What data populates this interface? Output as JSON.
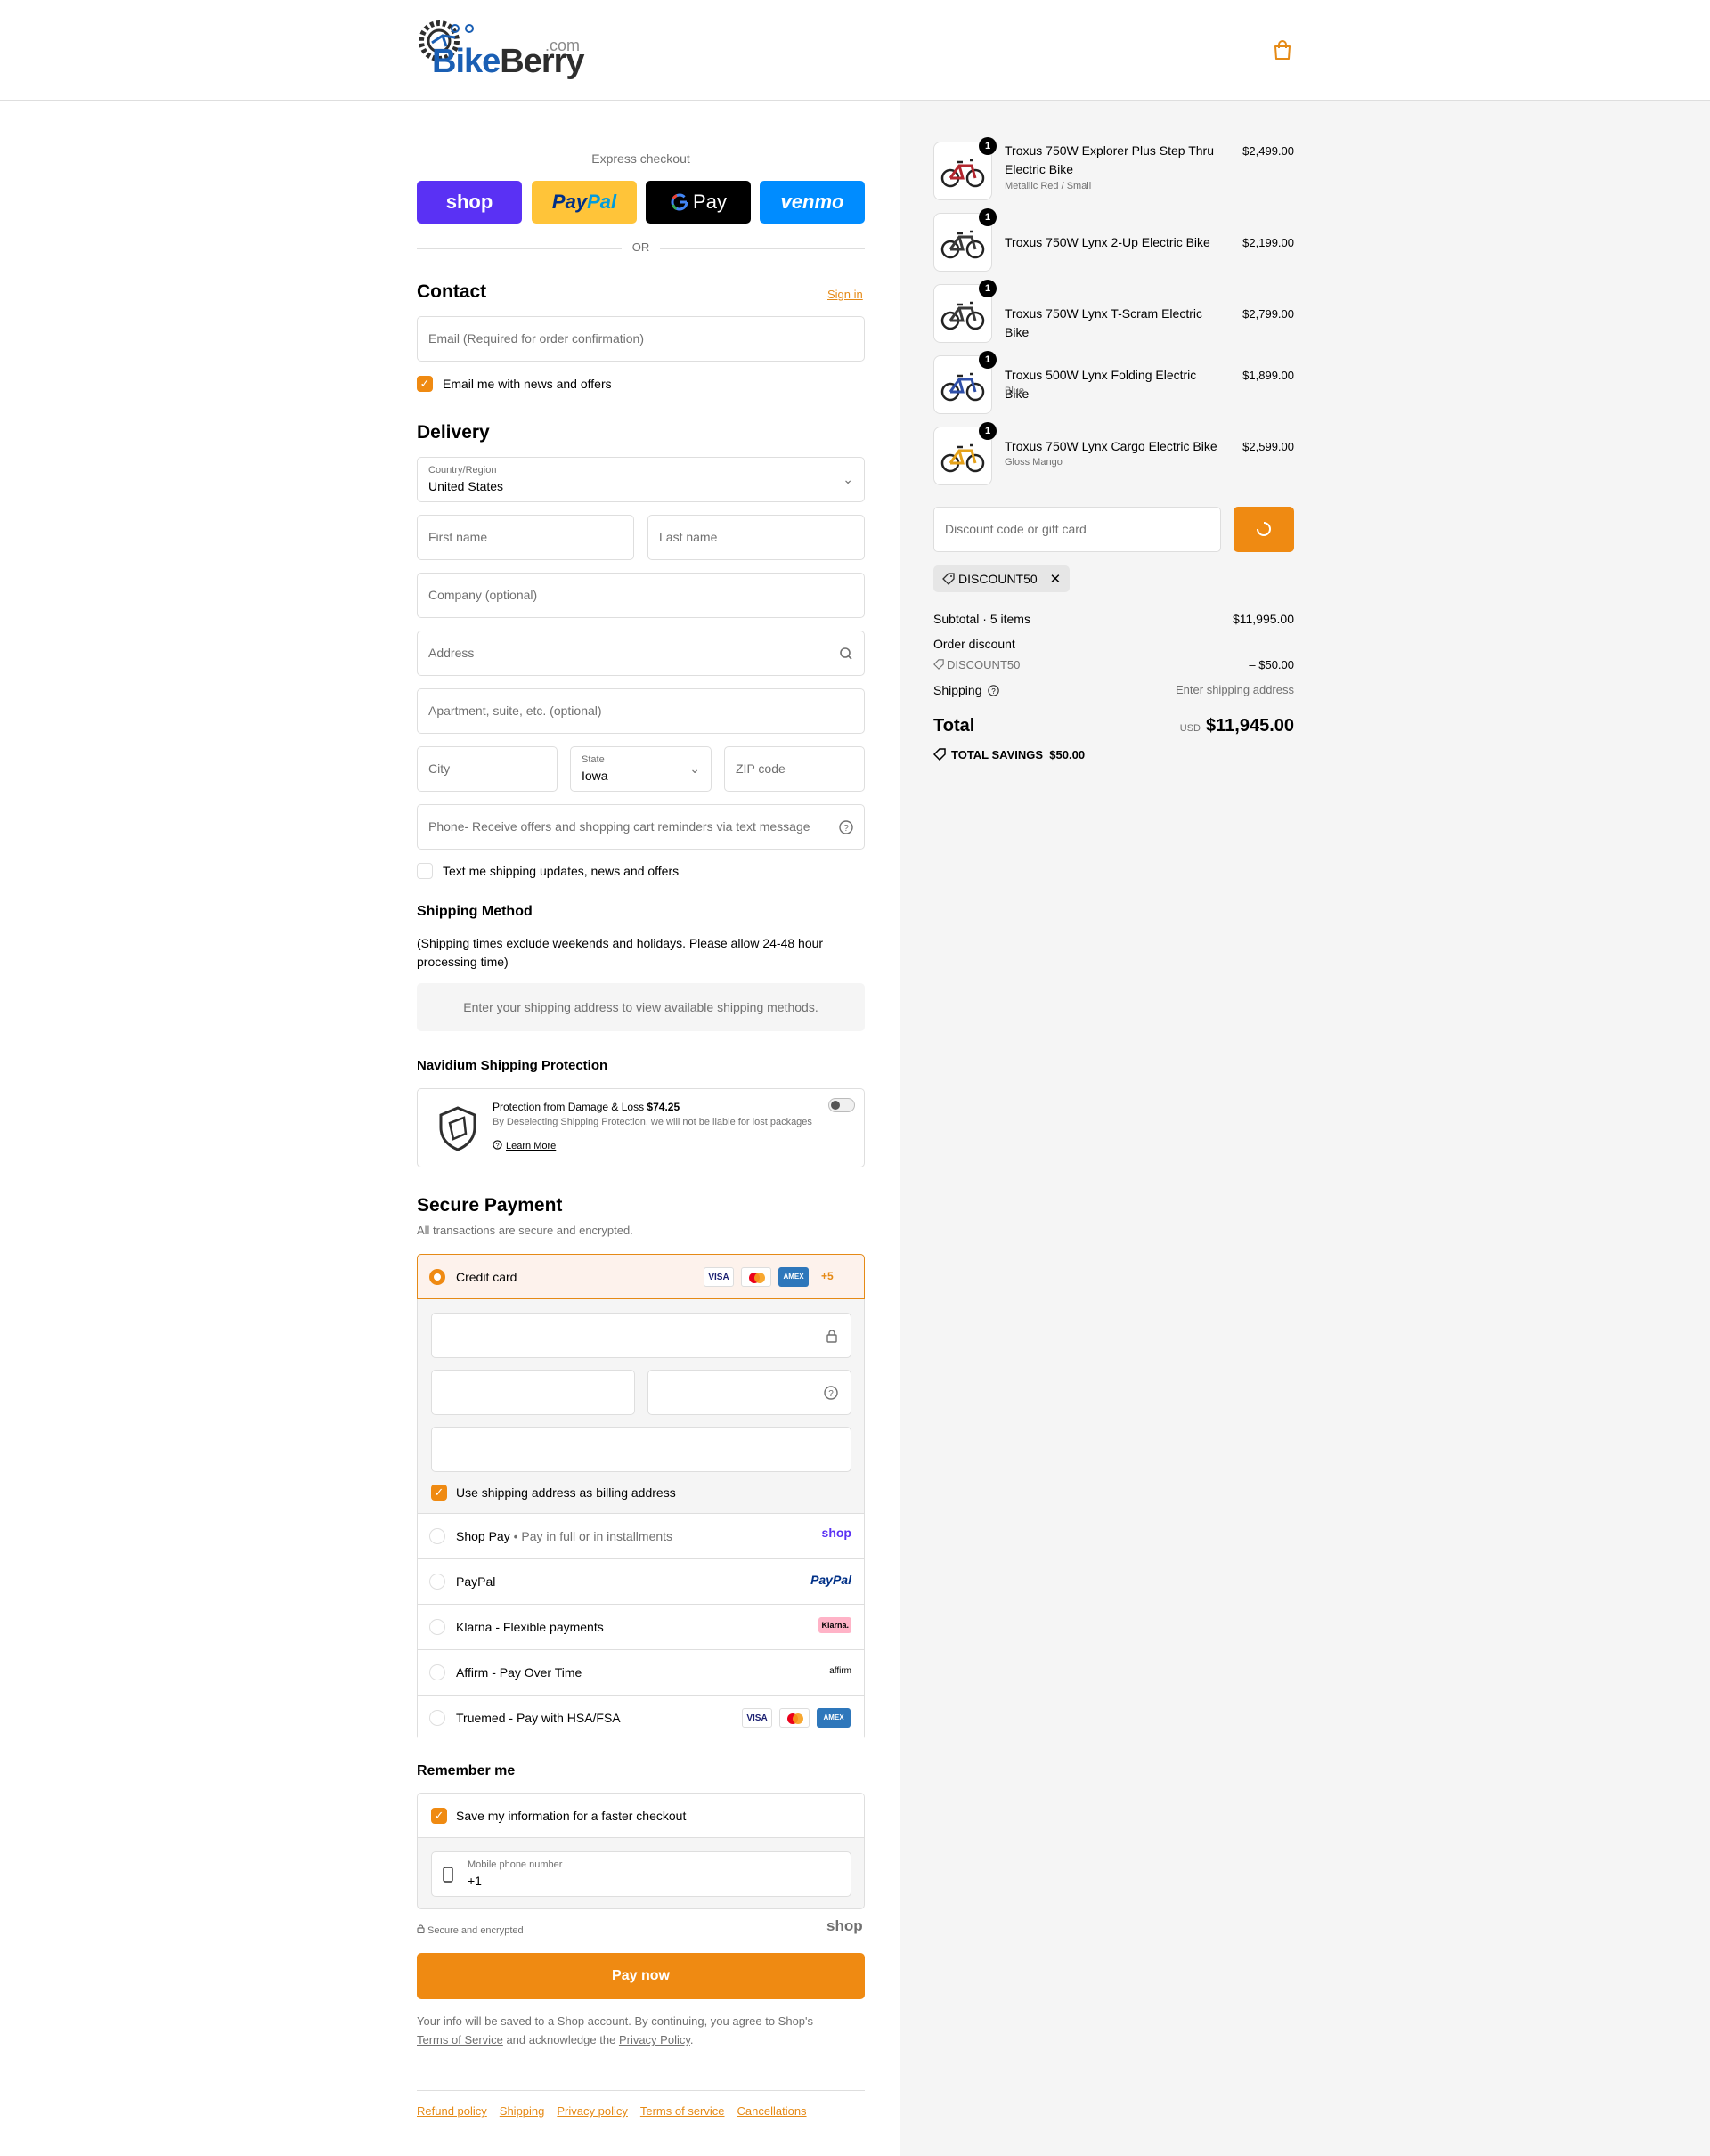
{
  "header": {
    "logo_text_1": "Bike",
    "logo_text_2": "Berry",
    "logo_com": ".com"
  },
  "express": {
    "label": "Express checkout",
    "shop": "shop",
    "paypal_1": "Pay",
    "paypal_2": "Pal",
    "gpay": "Pay",
    "venmo": "venmo",
    "or": "OR"
  },
  "contact": {
    "title": "Contact",
    "sign_in": "Sign in",
    "email_placeholder": "Email (Required for order confirmation)",
    "news_label": "Email me with news and offers"
  },
  "delivery": {
    "title": "Delivery",
    "country_label": "Country/Region",
    "country_value": "United States",
    "first_name": "First name",
    "last_name": "Last name",
    "company": "Company (optional)",
    "address": "Address",
    "apartment": "Apartment, suite, etc. (optional)",
    "city": "City",
    "state_label": "State",
    "state_value": "Iowa",
    "zip": "ZIP code",
    "phone": "Phone- Receive offers and shopping cart reminders via text message",
    "text_me": "Text me shipping updates, news and offers"
  },
  "shipping_method": {
    "title": "Shipping Method",
    "note": "(Shipping times exclude weekends and holidays. Please allow 24-48 hour processing time)",
    "info": "Enter your shipping address to view available shipping methods."
  },
  "protection": {
    "title": "Navidium Shipping Protection",
    "line1": "Protection from Damage & Loss",
    "amount": "$74.25",
    "line2": "By Deselecting Shipping Protection, we will not be liable for lost packages",
    "learn_more": "Learn More"
  },
  "payment": {
    "title": "Secure Payment",
    "subtitle": "All transactions are secure and encrypted.",
    "credit_card": "Credit card",
    "more_cards": "+5",
    "billing_label": "Use shipping address as billing address",
    "options": [
      {
        "label": "Shop Pay",
        "sub": "Pay in full or in installments",
        "logo": "shop"
      },
      {
        "label": "PayPal",
        "sub": "",
        "logo": "PayPal"
      },
      {
        "label": "Klarna - Flexible payments",
        "sub": "",
        "logo": "Klarna."
      },
      {
        "label": "Affirm - Pay Over Time",
        "sub": "",
        "logo": "affirm"
      },
      {
        "label": "Truemed - Pay with HSA/FSA",
        "sub": "",
        "logo": ""
      }
    ],
    "card_brands": [
      "VISA",
      "AMEX"
    ]
  },
  "remember": {
    "title": "Remember me",
    "save_label": "Save my information for a faster checkout",
    "phone_label": "Mobile phone number",
    "phone_value": "+1",
    "secure": "Secure and encrypted",
    "shop": "shop"
  },
  "pay_now": "Pay now",
  "legal": {
    "text1": "Your info will be saved to a Shop account. By continuing, you agree to Shop's",
    "tos": "Terms of Service",
    "text2": "and acknowledge the",
    "privacy": "Privacy Policy",
    "period": "."
  },
  "footer": [
    "Refund policy",
    "Shipping",
    "Privacy policy",
    "Terms of service",
    "Cancellations"
  ],
  "cart": {
    "items": [
      {
        "name": "Troxus 750W Explorer Plus Step Thru Electric Bike",
        "variant": "Metallic Red / Small",
        "price": "$2,499.00",
        "qty": "1",
        "color": "#b3262e"
      },
      {
        "name": "Troxus 750W Lynx 2-Up Electric Bike",
        "variant": "",
        "price": "$2,199.00",
        "qty": "1",
        "color": "#3a3a3a"
      },
      {
        "name": "Troxus 750W Lynx T-Scram Electric Bike",
        "variant": "",
        "price": "$2,799.00",
        "qty": "1",
        "color": "#3a3a3a"
      },
      {
        "name": "Troxus 500W Lynx Folding Electric Bike",
        "variant": "Blue",
        "price": "$1,899.00",
        "qty": "1",
        "color": "#2f4fa8"
      },
      {
        "name": "Troxus 750W Lynx Cargo Electric Bike",
        "variant": "Gloss Mango",
        "price": "$2,599.00",
        "qty": "1",
        "color": "#e5a21a"
      }
    ],
    "discount_placeholder": "Discount code or gift card",
    "applied_code": "DISCOUNT50",
    "subtotal_label": "Subtotal · 5 items",
    "subtotal": "$11,995.00",
    "order_discount_label": "Order discount",
    "discount_code": "DISCOUNT50",
    "discount_amount": "– $50.00",
    "shipping_label": "Shipping",
    "shipping_value": "Enter shipping address",
    "total_label": "Total",
    "currency": "USD",
    "total": "$11,945.00",
    "savings_label": "TOTAL SAVINGS",
    "savings": "$50.00"
  },
  "colors": {
    "accent": "#ef8a12",
    "link": "#e58a16",
    "shop": "#5a31f4",
    "venmo": "#008cff",
    "paypal_bg": "#ffc439"
  }
}
